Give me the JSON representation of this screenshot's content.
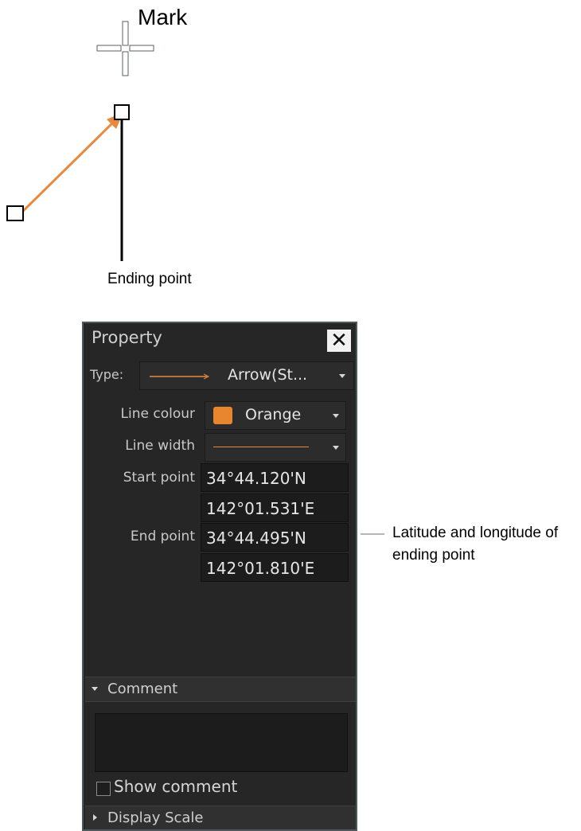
{
  "annotations": {
    "mark": "Mark",
    "ending_point": "Ending point",
    "latlon": "Latitude and longitude of ending point"
  },
  "panel": {
    "title": "Property",
    "close_icon": "close-icon",
    "type_label": "Type:",
    "type_value": "Arrow(St...",
    "line_colour_label": "Line colour",
    "line_colour_value": "Orange",
    "line_colour_hex": "#e8852f",
    "line_width_label": "Line width",
    "start_point_label": "Start point",
    "start_lat": "34°44.120'N",
    "start_lon": "142°01.531'E",
    "end_point_label": "End point",
    "end_lat": "34°44.495'N",
    "end_lon": "142°01.810'E",
    "comment_section": "Comment",
    "show_comment_label": "Show comment",
    "show_comment_checked": false,
    "display_scale_section": "Display Scale"
  }
}
